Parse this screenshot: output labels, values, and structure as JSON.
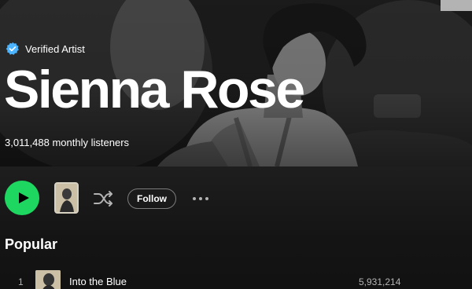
{
  "artist": {
    "verified_label": "Verified Artist",
    "name": "Sienna Rose",
    "monthly_listeners": "3,011,488 monthly listeners"
  },
  "actions": {
    "follow_label": "Follow",
    "more_label": "• • •"
  },
  "popular": {
    "title": "Popular",
    "tracks": [
      {
        "number": "1",
        "title": "Into the Blue",
        "plays": "5,931,214"
      }
    ]
  },
  "colors": {
    "accent_green": "#1ed760",
    "verified_blue": "#4cb3ff",
    "background": "#121212"
  },
  "icons": {
    "verified": "verified-badge-icon",
    "play": "play-icon",
    "shuffle": "shuffle-icon",
    "more": "more-options-icon"
  }
}
